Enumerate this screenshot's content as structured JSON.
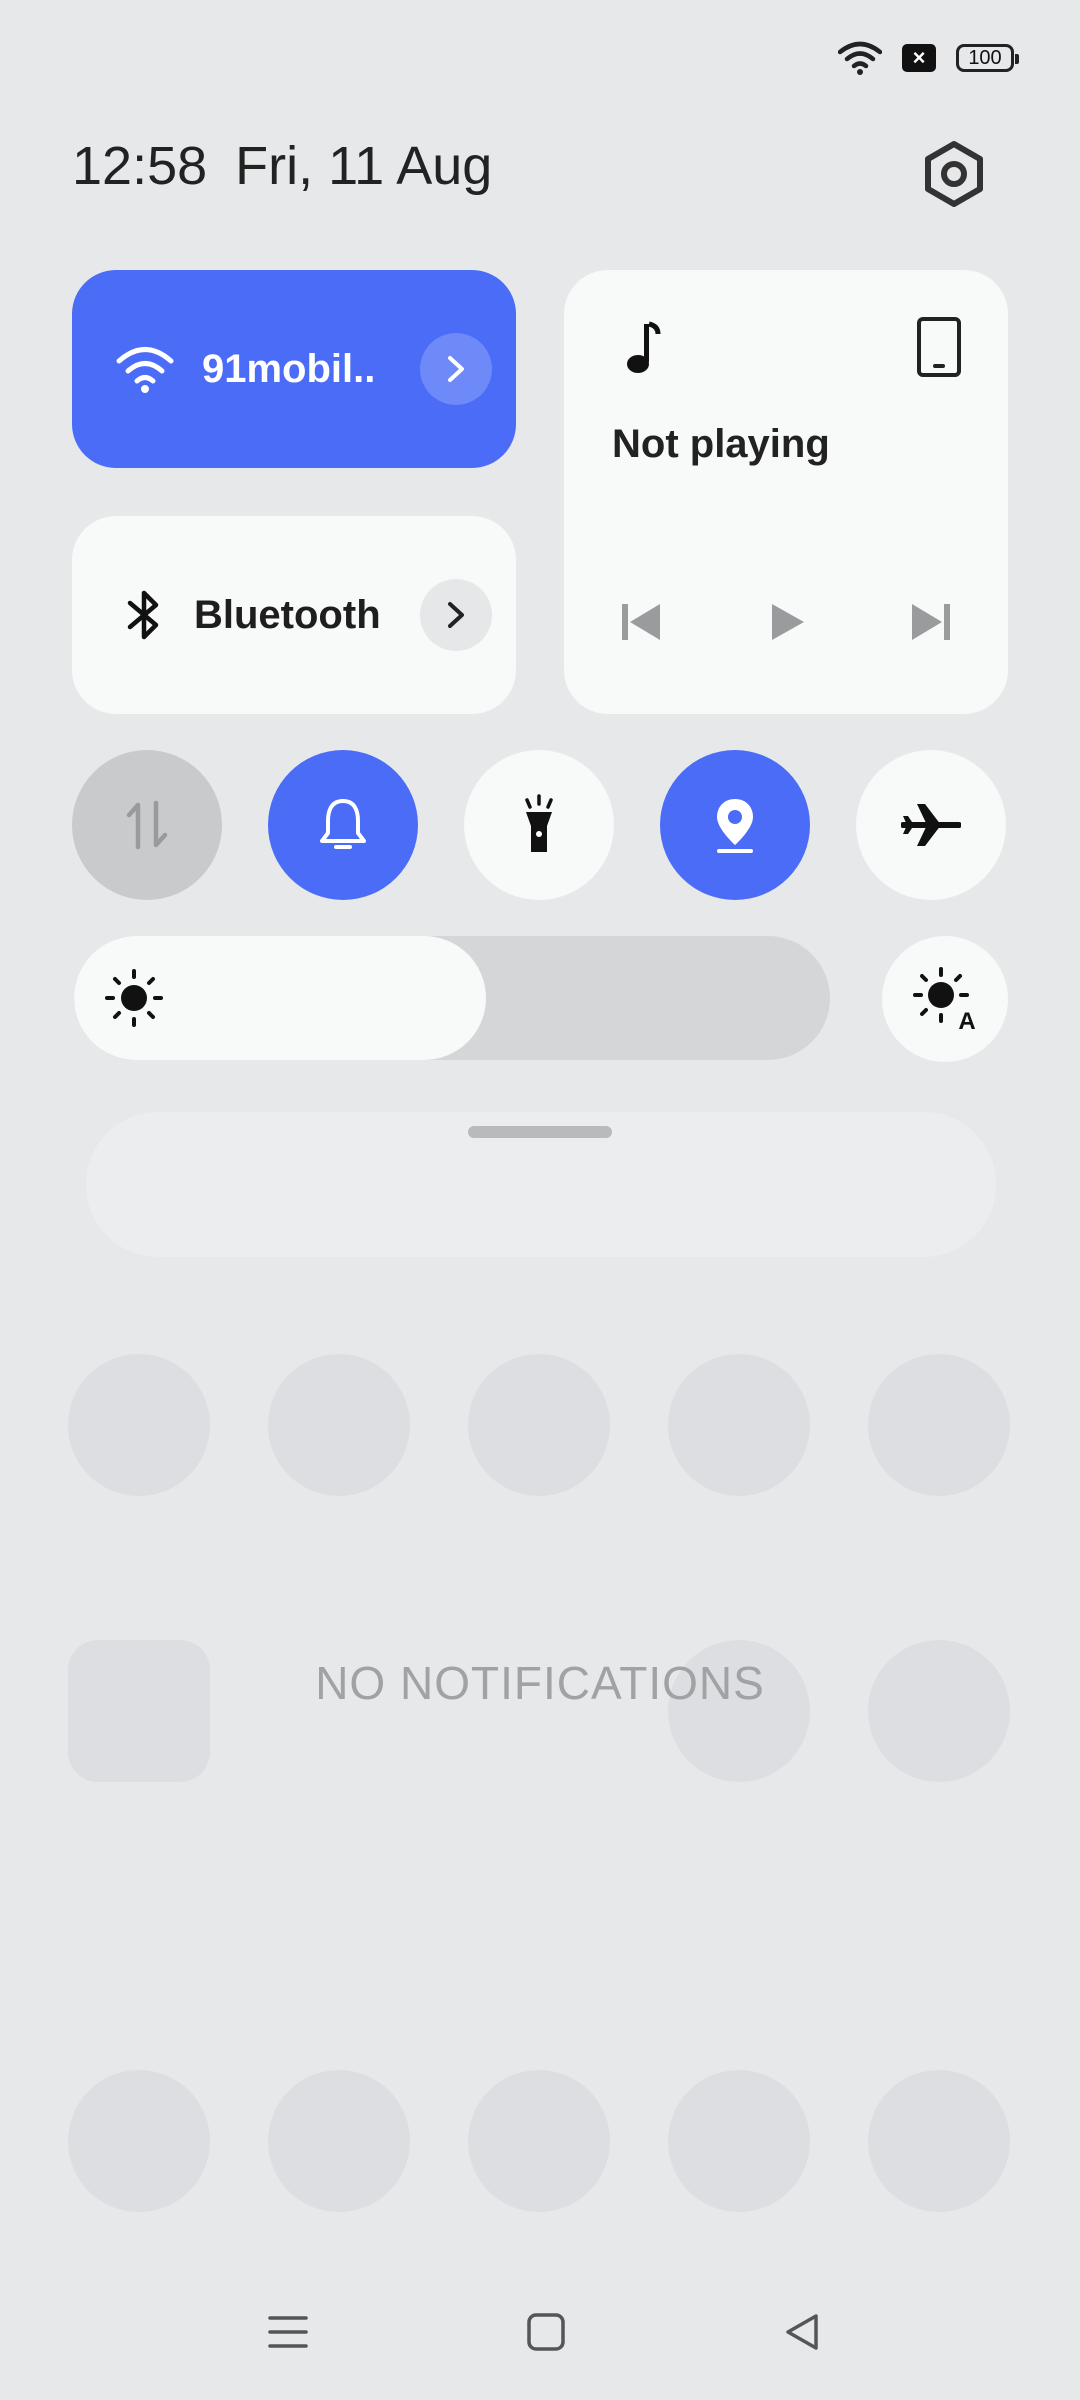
{
  "status_bar": {
    "battery_level": "100",
    "signal_indicator": "×",
    "icons": [
      "wifi-icon",
      "no-sim-icon",
      "battery-icon"
    ]
  },
  "header": {
    "time": "12:58",
    "date": "Fri, 11 Aug"
  },
  "tiles": {
    "wifi": {
      "label": "91mobil..",
      "active": true,
      "icon": "wifi-icon"
    },
    "bluetooth": {
      "label": "Bluetooth",
      "active": false,
      "icon": "bluetooth-icon"
    }
  },
  "media": {
    "status": "Not playing",
    "icons": [
      "music-note-icon",
      "phone-device-icon",
      "previous-icon",
      "play-icon",
      "next-icon"
    ]
  },
  "toggles": [
    {
      "name": "mobile-data",
      "active": false,
      "icon": "data-arrows-icon"
    },
    {
      "name": "sound",
      "active": true,
      "icon": "bell-icon"
    },
    {
      "name": "flashlight",
      "active": false,
      "icon": "flashlight-icon"
    },
    {
      "name": "location",
      "active": true,
      "icon": "location-pin-icon"
    },
    {
      "name": "airplane-mode",
      "active": false,
      "icon": "airplane-icon"
    }
  ],
  "brightness": {
    "level": 0.545,
    "auto_icon": "auto-brightness-icon"
  },
  "notifications": {
    "empty_text": "NO NOTIFICATIONS"
  },
  "colors": {
    "accent": "#4a6cf7",
    "tile_bg": "#f8f9f9",
    "shade_bg": "#e6e8ea",
    "inactive_toggle": "#c9cacc"
  }
}
